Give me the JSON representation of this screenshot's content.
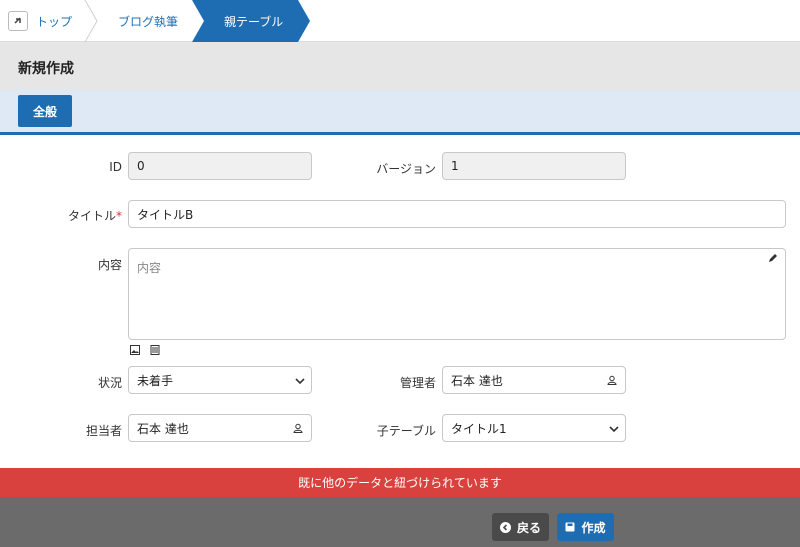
{
  "breadcrumb": {
    "items": [
      {
        "label": "トップ"
      },
      {
        "label": "ブログ執筆"
      },
      {
        "label": "親テーブル"
      }
    ]
  },
  "page": {
    "title": "新規作成"
  },
  "tabs": [
    {
      "label": "全般",
      "active": true
    }
  ],
  "form": {
    "id": {
      "label": "ID",
      "value": "0"
    },
    "version": {
      "label": "バージョン",
      "value": "1"
    },
    "title": {
      "label": "タイトル",
      "required_mark": "*",
      "value": "タイトルB"
    },
    "content": {
      "label": "内容",
      "placeholder": "内容"
    },
    "status": {
      "label": "状況",
      "value": "未着手"
    },
    "manager": {
      "label": "管理者",
      "value": "石本 達也"
    },
    "owner": {
      "label": "担当者",
      "value": "石本 達也"
    },
    "child_table": {
      "label": "子テーブル",
      "value": "タイトル1"
    }
  },
  "alert": {
    "message": "既に他のデータと紐づけられています"
  },
  "buttons": {
    "back": "戻る",
    "create": "作成"
  },
  "colors": {
    "accent": "#1e6db3",
    "alert": "#d9413f",
    "footer": "#6b6b6b"
  }
}
